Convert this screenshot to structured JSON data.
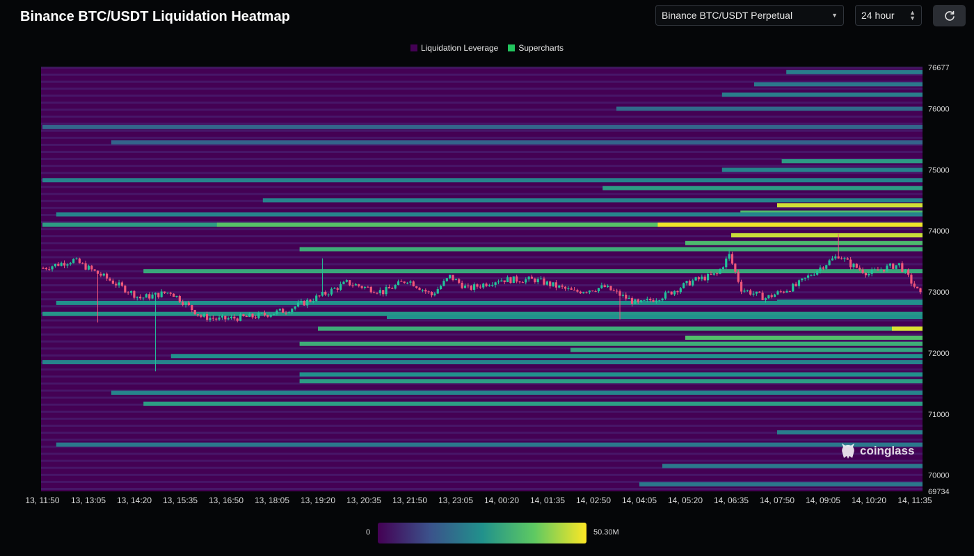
{
  "header": {
    "title": "Binance BTC/USDT Liquidation Heatmap",
    "market_select": "Binance BTC/USDT Perpetual",
    "range_select": "24 hour",
    "refresh_icon": "refresh-icon"
  },
  "legend": {
    "items": [
      {
        "label": "Liquidation Leverage",
        "color": "#440154"
      },
      {
        "label": "Supercharts",
        "color": "#22c55e"
      }
    ]
  },
  "colorbar": {
    "min_label": "0",
    "max_label": "50.30M"
  },
  "watermark": {
    "text": "coinglass",
    "icon": "coinglass-logo-icon"
  },
  "colors": {
    "background": "#050608",
    "up": "#22c39a",
    "down": "#f0567a"
  },
  "chart_data": {
    "type": "heatmap",
    "title": "Binance BTC/USDT Liquidation Heatmap",
    "ylim": [
      69734,
      76677
    ],
    "y_ticks": [
      76677,
      76000,
      75000,
      74000,
      73000,
      72000,
      71000,
      70000,
      69734
    ],
    "x_ticks": [
      "13, 11:50",
      "13, 13:05",
      "13, 14:20",
      "13, 15:35",
      "13, 16:50",
      "13, 18:05",
      "13, 19:20",
      "13, 20:35",
      "13, 21:50",
      "13, 23:05",
      "14, 00:20",
      "14, 01:35",
      "14, 02:50",
      "14, 04:05",
      "14, 05:20",
      "14, 06:35",
      "14, 07:50",
      "14, 09:05",
      "14, 10:20",
      "14, 11:35"
    ],
    "x_range_index": [
      0,
      19
    ],
    "colorscale": {
      "min": 0,
      "max_label": "50.30M"
    },
    "levels": [
      {
        "price": 74100,
        "start": 0.0,
        "intensity": 0.55
      },
      {
        "price": 74100,
        "start": 3.8,
        "intensity": 0.72
      },
      {
        "price": 74100,
        "start": 13.4,
        "intensity": 0.98
      },
      {
        "price": 74420,
        "start": 16.0,
        "intensity": 0.93
      },
      {
        "price": 74300,
        "start": 15.2,
        "intensity": 0.7
      },
      {
        "price": 73930,
        "start": 15.0,
        "intensity": 0.6
      },
      {
        "price": 73930,
        "start": 15.0,
        "intensity": 0.92
      },
      {
        "price": 73800,
        "start": 14.0,
        "intensity": 0.68
      },
      {
        "price": 73700,
        "start": 5.6,
        "intensity": 0.62
      },
      {
        "price": 73340,
        "start": 2.2,
        "intensity": 0.6
      },
      {
        "price": 74830,
        "start": 0.0,
        "intensity": 0.45
      },
      {
        "price": 74700,
        "start": 12.2,
        "intensity": 0.55
      },
      {
        "price": 75000,
        "start": 14.8,
        "intensity": 0.45
      },
      {
        "price": 75140,
        "start": 16.1,
        "intensity": 0.55
      },
      {
        "price": 74270,
        "start": 0.3,
        "intensity": 0.45
      },
      {
        "price": 74500,
        "start": 4.8,
        "intensity": 0.45
      },
      {
        "price": 72400,
        "start": 6.0,
        "intensity": 0.62
      },
      {
        "price": 72400,
        "start": 18.5,
        "intensity": 0.95
      },
      {
        "price": 72250,
        "start": 14.0,
        "intensity": 0.7
      },
      {
        "price": 72150,
        "start": 5.6,
        "intensity": 0.62
      },
      {
        "price": 72050,
        "start": 11.5,
        "intensity": 0.58
      },
      {
        "price": 71950,
        "start": 2.8,
        "intensity": 0.5
      },
      {
        "price": 71850,
        "start": 0.0,
        "intensity": 0.45
      },
      {
        "price": 71650,
        "start": 5.6,
        "intensity": 0.5
      },
      {
        "price": 71540,
        "start": 5.6,
        "intensity": 0.55
      },
      {
        "price": 71350,
        "start": 1.5,
        "intensity": 0.45
      },
      {
        "price": 71170,
        "start": 2.2,
        "intensity": 0.55
      },
      {
        "price": 72820,
        "start": 0.3,
        "intensity": 0.5
      },
      {
        "price": 72640,
        "start": 0.0,
        "intensity": 0.52
      },
      {
        "price": 72840,
        "start": 16.0,
        "intensity": 0.5
      },
      {
        "price": 72590,
        "start": 7.5,
        "intensity": 0.5
      },
      {
        "price": 70700,
        "start": 16.0,
        "intensity": 0.42
      },
      {
        "price": 70500,
        "start": 0.3,
        "intensity": 0.4
      },
      {
        "price": 70150,
        "start": 13.5,
        "intensity": 0.4
      },
      {
        "price": 69850,
        "start": 13.0,
        "intensity": 0.4
      },
      {
        "price": 76600,
        "start": 16.2,
        "intensity": 0.42
      },
      {
        "price": 76400,
        "start": 15.5,
        "intensity": 0.4
      },
      {
        "price": 76230,
        "start": 14.8,
        "intensity": 0.42
      },
      {
        "price": 75700,
        "start": 0.0,
        "intensity": 0.33
      },
      {
        "price": 75450,
        "start": 1.5,
        "intensity": 0.32
      },
      {
        "price": 76000,
        "start": 12.5,
        "intensity": 0.35
      }
    ],
    "candles": {
      "count": 290,
      "open": 73390,
      "anchors": [
        [
          0,
          73390
        ],
        [
          10,
          73520
        ],
        [
          20,
          73250
        ],
        [
          32,
          72900
        ],
        [
          42,
          73000
        ],
        [
          52,
          72600
        ],
        [
          58,
          72550
        ],
        [
          70,
          72600
        ],
        [
          80,
          72700
        ],
        [
          92,
          72950
        ],
        [
          100,
          73150
        ],
        [
          112,
          73000
        ],
        [
          120,
          73200
        ],
        [
          128,
          72950
        ],
        [
          134,
          73250
        ],
        [
          140,
          73050
        ],
        [
          150,
          73200
        ],
        [
          162,
          73200
        ],
        [
          175,
          73000
        ],
        [
          185,
          73080
        ],
        [
          196,
          72800
        ],
        [
          205,
          72950
        ],
        [
          214,
          73180
        ],
        [
          222,
          73290
        ],
        [
          226,
          73600
        ],
        [
          230,
          73050
        ],
        [
          238,
          72900
        ],
        [
          248,
          73100
        ],
        [
          256,
          73400
        ],
        [
          262,
          73600
        ],
        [
          266,
          73450
        ],
        [
          272,
          73300
        ],
        [
          278,
          73400
        ],
        [
          282,
          73450
        ],
        [
          289,
          72950
        ]
      ],
      "wicks": [
        {
          "i": 37,
          "low": 71700
        },
        {
          "i": 18,
          "low": 72500
        },
        {
          "i": 226,
          "high": 73700
        },
        {
          "i": 262,
          "high": 73950
        },
        {
          "i": 190,
          "low": 72550
        },
        {
          "i": 92,
          "high": 73550
        }
      ]
    }
  }
}
